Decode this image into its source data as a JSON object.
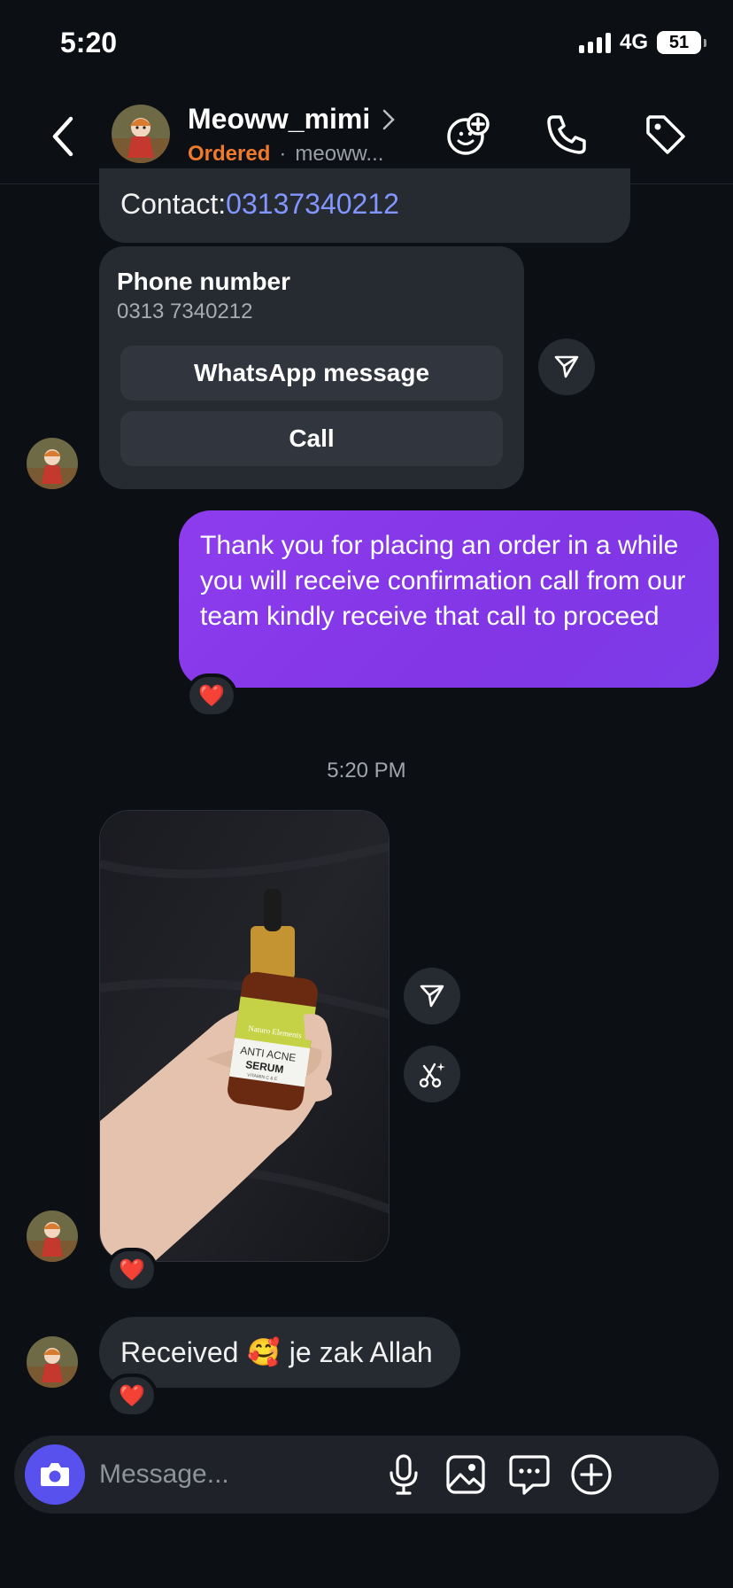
{
  "status": {
    "time": "5:20",
    "network": "4G",
    "battery": "51"
  },
  "header": {
    "name": "Meoww_mimi",
    "status_label": "Ordered",
    "separator": "·",
    "username": "meoww..."
  },
  "messages": {
    "contact_prefix": "Contact:",
    "contact_number": "03137340212",
    "phone_card": {
      "title": "Phone number",
      "number": "0313 7340212",
      "whatsapp_label": "WhatsApp message",
      "call_label": "Call"
    },
    "sent_text": "Thank you for placing an order in a while you will receive confirmation call from our team kindly receive that call to proceed",
    "timestamp": "5:20 PM",
    "photo_product": {
      "brand": "Naturo Elements",
      "line1": "ANTI ACNE",
      "line2": "SERUM",
      "line3": "VITAMIN C & E"
    },
    "received_text_before": "Received",
    "received_emoji": "🥰",
    "received_text_after": "je zak Allah"
  },
  "reaction_emoji": "❤️",
  "composer": {
    "placeholder": "Message..."
  },
  "colors": {
    "background": "#0c0f14",
    "bubble": "#262a31",
    "sent_bubble": "#8236e6",
    "ordered": "#f07a2c",
    "link": "#8296ff",
    "camera": "#5851ee"
  }
}
